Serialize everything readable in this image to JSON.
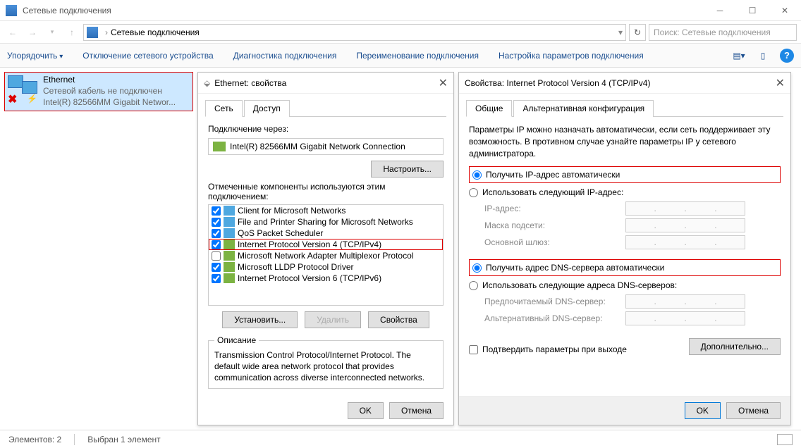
{
  "window": {
    "title": "Сетевые подключения",
    "breadcrumb": "Сетевые подключения",
    "search_placeholder": "Поиск: Сетевые подключения"
  },
  "cmdbar": {
    "organize": "Упорядочить",
    "disable": "Отключение сетевого устройства",
    "diagnose": "Диагностика подключения",
    "rename": "Переименование подключения",
    "settings": "Настройка параметров подключения"
  },
  "connection": {
    "name": "Ethernet",
    "status": "Сетевой кабель не подключен",
    "device": "Intel(R) 82566MM Gigabit Networ..."
  },
  "eth_dlg": {
    "title": "Ethernet: свойства",
    "tab_net": "Сеть",
    "tab_access": "Доступ",
    "connect_via": "Подключение через:",
    "adapter": "Intel(R) 82566MM Gigabit Network Connection",
    "configure": "Настроить...",
    "components_label": "Отмеченные компоненты используются этим подключением:",
    "components": [
      {
        "checked": true,
        "icon": "blue",
        "label": "Client for Microsoft Networks"
      },
      {
        "checked": true,
        "icon": "blue",
        "label": "File and Printer Sharing for Microsoft Networks"
      },
      {
        "checked": true,
        "icon": "blue",
        "label": "QoS Packet Scheduler"
      },
      {
        "checked": true,
        "icon": "green",
        "label": "Internet Protocol Version 4 (TCP/IPv4)",
        "highlight": true
      },
      {
        "checked": false,
        "icon": "green",
        "label": "Microsoft Network Adapter Multiplexor Protocol"
      },
      {
        "checked": true,
        "icon": "green",
        "label": "Microsoft LLDP Protocol Driver"
      },
      {
        "checked": true,
        "icon": "green",
        "label": "Internet Protocol Version 6 (TCP/IPv6)"
      }
    ],
    "install": "Установить...",
    "uninstall": "Удалить",
    "properties": "Свойства",
    "desc_title": "Описание",
    "desc_text": "Transmission Control Protocol/Internet Protocol. The default wide area network protocol that provides communication across diverse interconnected networks.",
    "ok": "OK",
    "cancel": "Отмена"
  },
  "ipv4_dlg": {
    "title": "Свойства: Internet Protocol Version 4 (TCP/IPv4)",
    "tab_general": "Общие",
    "tab_alt": "Альтернативная конфигурация",
    "intro": "Параметры IP можно назначать автоматически, если сеть поддерживает эту возможность. В противном случае узнайте параметры IP у сетевого администратора.",
    "radio_ip_auto": "Получить IP-адрес автоматически",
    "radio_ip_manual": "Использовать следующий IP-адрес:",
    "ip_label": "IP-адрес:",
    "mask_label": "Маска подсети:",
    "gw_label": "Основной шлюз:",
    "radio_dns_auto": "Получить адрес DNS-сервера автоматически",
    "radio_dns_manual": "Использовать следующие адреса DNS-серверов:",
    "dns1_label": "Предпочитаемый DNS-сервер:",
    "dns2_label": "Альтернативный DNS-сервер:",
    "confirm_exit": "Подтвердить параметры при выходе",
    "advanced": "Дополнительно...",
    "ok": "OK",
    "cancel": "Отмена"
  },
  "statusbar": {
    "count": "Элементов: 2",
    "selection": "Выбран 1 элемент"
  }
}
